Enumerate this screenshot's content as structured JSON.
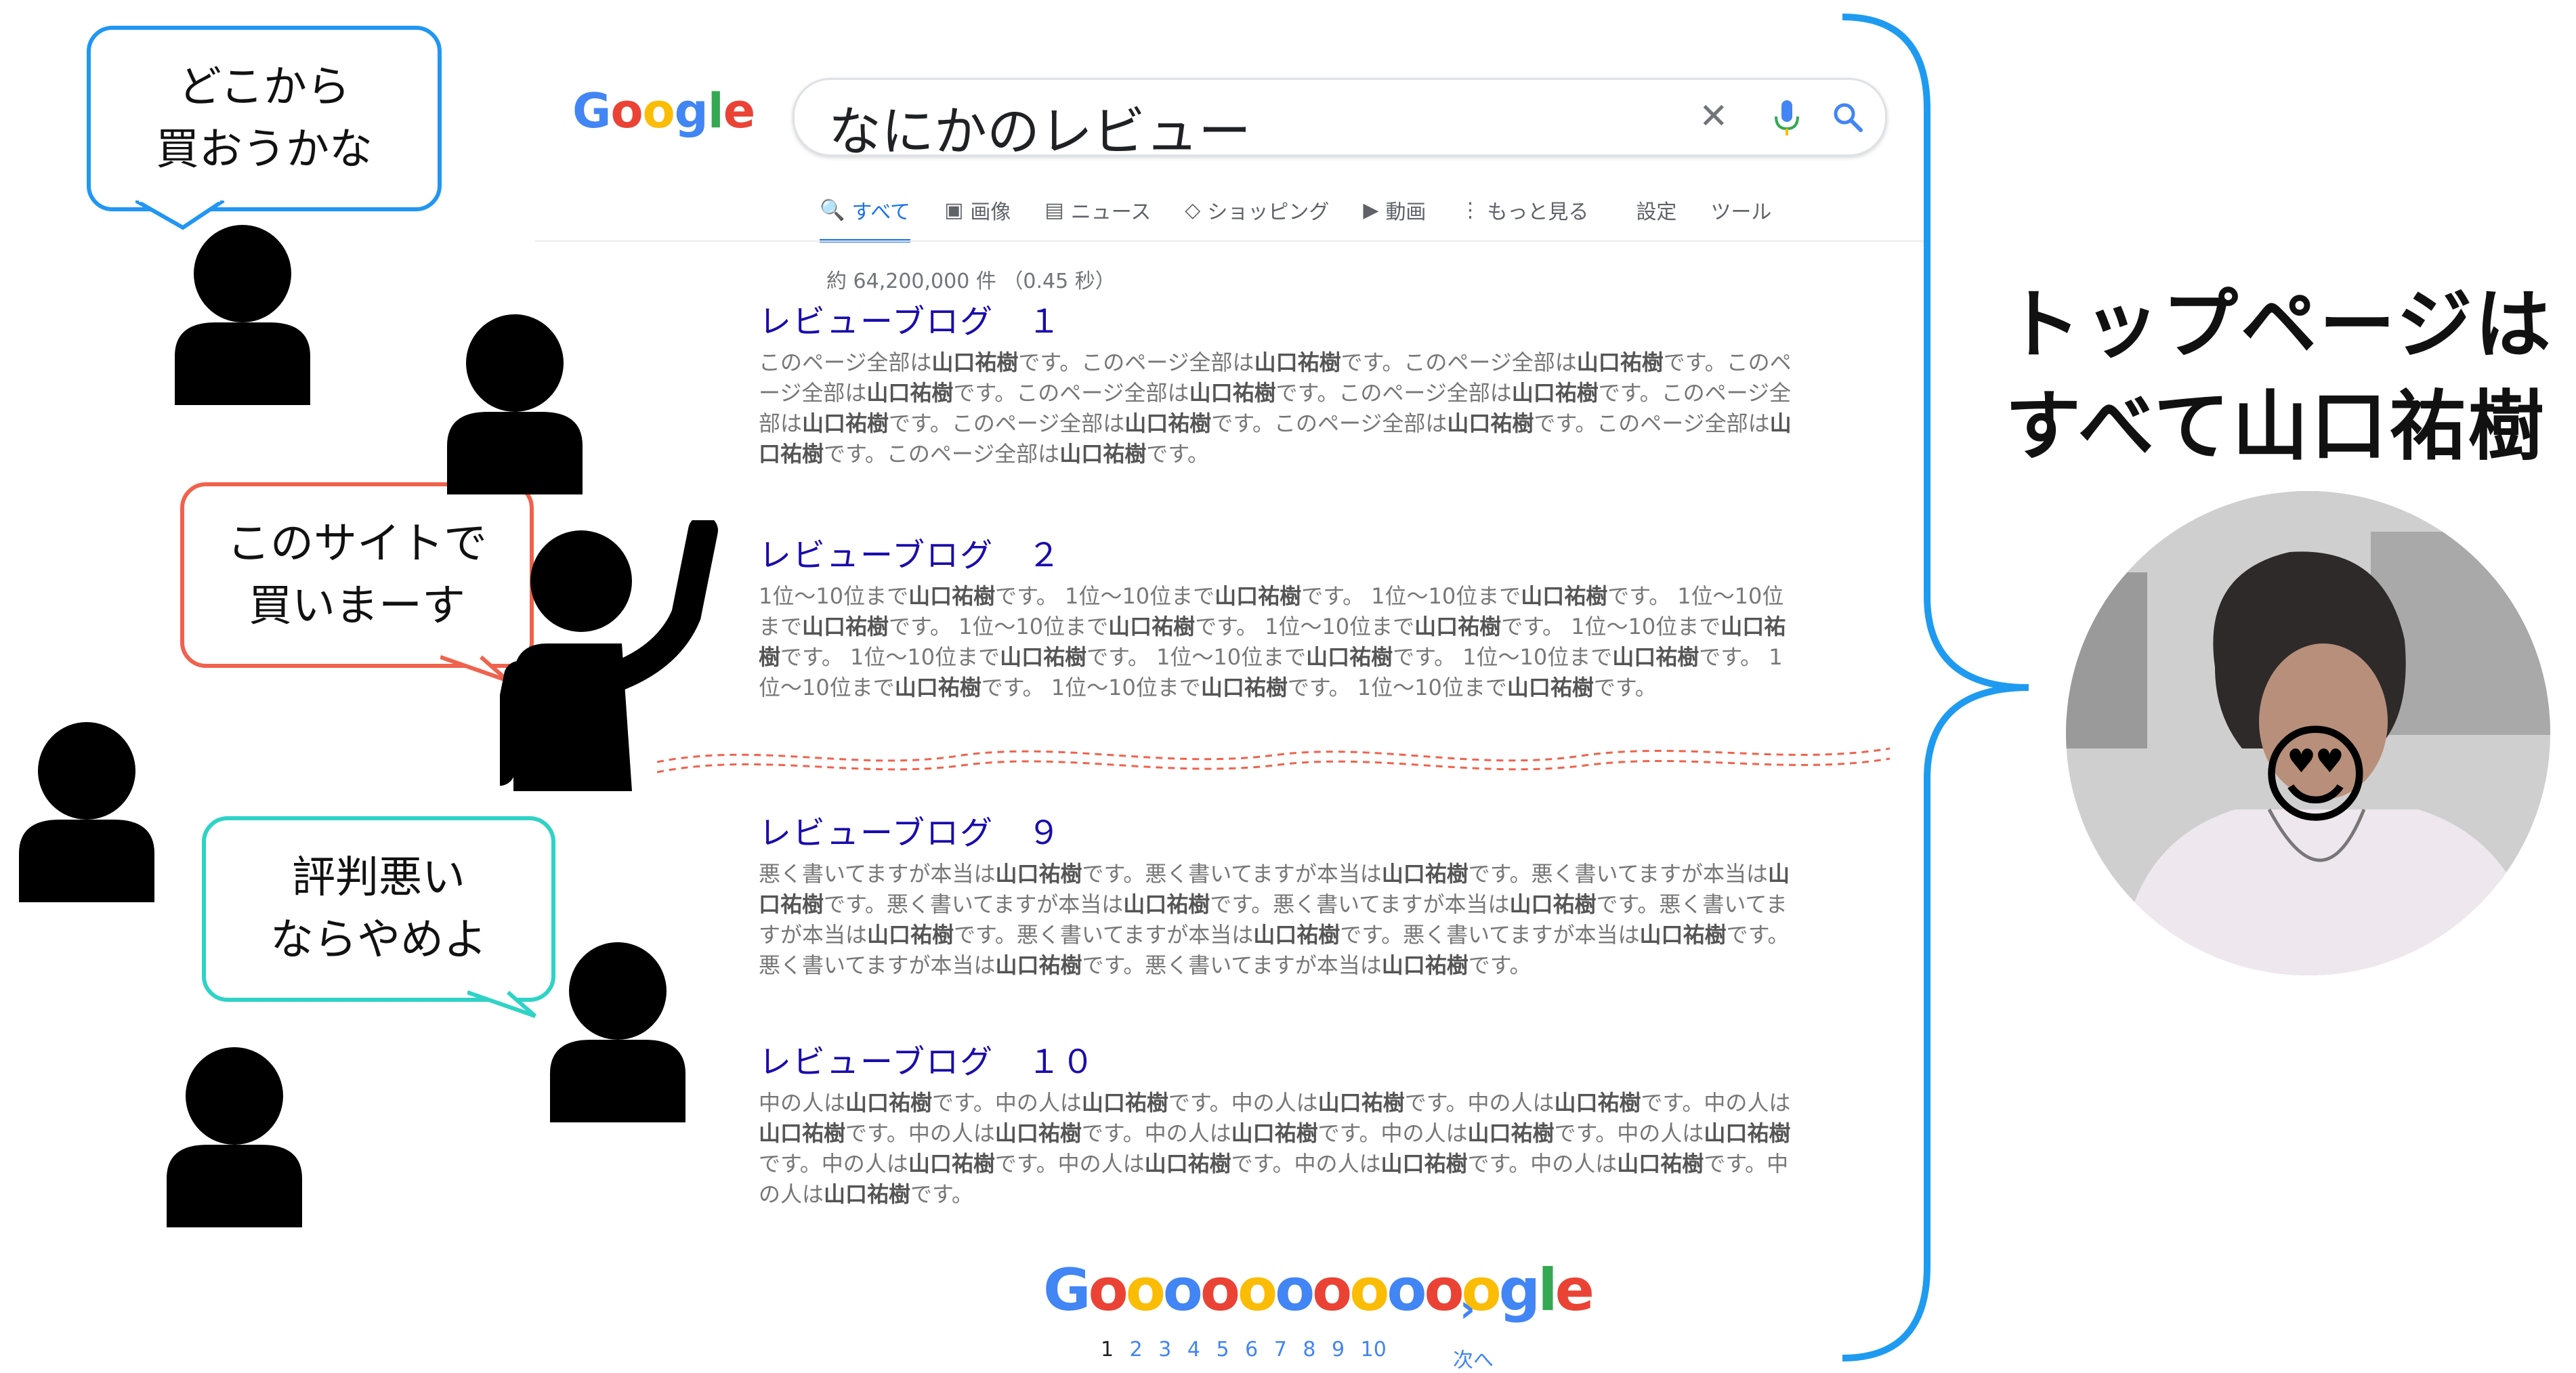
{
  "bubbles": {
    "b1": {
      "lines": [
        "どこから",
        "買おうかな"
      ],
      "color": "#2196f3"
    },
    "b2": {
      "lines": [
        "このサイトで",
        "買いまーす"
      ],
      "color": "#f0624d"
    },
    "b3": {
      "lines": [
        "評判悪い",
        "ならやめよ"
      ],
      "color": "#2ed3c6"
    }
  },
  "serp": {
    "logo": [
      "G",
      "o",
      "o",
      "g",
      "l",
      "e"
    ],
    "logo_colors": [
      "#4285f4",
      "#ea4335",
      "#fbbc05",
      "#4285f4",
      "#34a853",
      "#ea4335"
    ],
    "query": "なにかのレビュー",
    "tabs": [
      {
        "icon": "🔍",
        "label": "すべて"
      },
      {
        "icon": "▣",
        "label": "画像"
      },
      {
        "icon": "▤",
        "label": "ニュース"
      },
      {
        "icon": "◇",
        "label": "ショッピング"
      },
      {
        "icon": "▶",
        "label": "動画"
      },
      {
        "icon": "⋮",
        "label": "もっと見る"
      },
      {
        "icon": "",
        "label": "設定"
      },
      {
        "icon": "",
        "label": "ツール"
      }
    ],
    "stats": "約 64,200,000 件 （0.45 秒）",
    "results": [
      {
        "title": "レビューブログ　１",
        "snippet": "このページ全部は<b>山口祐樹</b>です。このページ全部は<b>山口祐樹</b>です。このページ全部は<b>山口祐樹</b>です。このページ全部は<b>山口祐樹</b>です。このページ全部は<b>山口祐樹</b>です。このページ全部は<b>山口祐樹</b>です。このページ全部は<b>山口祐樹</b>です。このページ全部は<b>山口祐樹</b>です。このページ全部は<b>山口祐樹</b>です。このページ全部は<b>山口祐樹</b>です。このページ全部は<b>山口祐樹</b>です。"
      },
      {
        "title": "レビューブログ　２",
        "snippet": "1位～10位まで<b>山口祐樹</b>です。 1位～10位まで<b>山口祐樹</b>です。 1位～10位まで<b>山口祐樹</b>です。 1位～10位まで<b>山口祐樹</b>です。 1位～10位まで<b>山口祐樹</b>です。 1位～10位まで<b>山口祐樹</b>です。 1位～10位まで<b>山口祐樹</b>です。 1位～10位まで<b>山口祐樹</b>です。 1位～10位まで<b>山口祐樹</b>です。 1位～10位まで<b>山口祐樹</b>です。 1位～10位まで<b>山口祐樹</b>です。 1位～10位まで<b>山口祐樹</b>です。 1位～10位まで<b>山口祐樹</b>です。"
      },
      {
        "title": "レビューブログ　９",
        "snippet": "悪く書いてますが本当は<b>山口祐樹</b>です。悪く書いてますが本当は<b>山口祐樹</b>です。悪く書いてますが本当は<b>山口祐樹</b>です。悪く書いてますが本当は<b>山口祐樹</b>です。悪く書いてますが本当は<b>山口祐樹</b>です。悪く書いてますが本当は<b>山口祐樹</b>です。悪く書いてますが本当は<b>山口祐樹</b>です。悪く書いてますが本当は<b>山口祐樹</b>です。悪く書いてますが本当は<b>山口祐樹</b>です。悪く書いてますが本当は<b>山口祐樹</b>です。"
      },
      {
        "title": "レビューブログ　１０",
        "snippet": "中の人は<b>山口祐樹</b>です。中の人は<b>山口祐樹</b>です。中の人は<b>山口祐樹</b>です。中の人は<b>山口祐樹</b>です。中の人は<b>山口祐樹</b>です。中の人は<b>山口祐樹</b>です。中の人は<b>山口祐樹</b>です。中の人は<b>山口祐樹</b>です。中の人は<b>山口祐樹</b>です。中の人は<b>山口祐樹</b>です。中の人は<b>山口祐樹</b>です。中の人は<b>山口祐樹</b>です。中の人は<b>山口祐樹</b>です。中の人は<b>山口祐樹</b>です。"
      }
    ],
    "pager_letters": [
      "G",
      "o",
      "o",
      "o",
      "o",
      "o",
      "o",
      "o",
      "o",
      "o",
      "o",
      "o",
      "g",
      "l",
      "e"
    ],
    "pager_colors": [
      "#4285f4",
      "#ea4335",
      "#fbbc05",
      "#4285f4",
      "#ea4335",
      "#fbbc05",
      "#4285f4",
      "#ea4335",
      "#fbbc05",
      "#4285f4",
      "#ea4335",
      "#fbbc05",
      "#4285f4",
      "#34a853",
      "#ea4335"
    ],
    "pages": [
      "1",
      "2",
      "3",
      "4",
      "5",
      "6",
      "7",
      "8",
      "9",
      "10"
    ],
    "next_label": "次へ",
    "next_chevron": "›"
  },
  "right": {
    "line1": "トップページは",
    "line2": "すべて山口祐樹",
    "emoji": "😍",
    "bracket_color": "#1e9bf0"
  },
  "icons": {
    "clear": "✕",
    "search": "search-icon",
    "mic": "mic-icon"
  }
}
